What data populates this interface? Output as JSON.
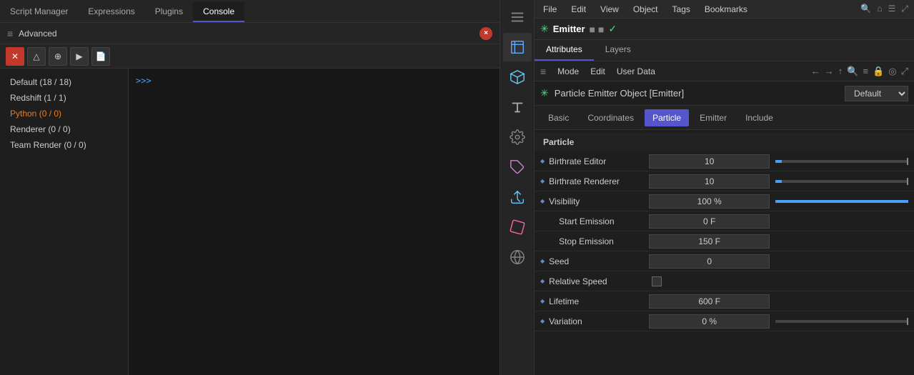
{
  "left_panel": {
    "tabs": [
      {
        "label": "Script Manager",
        "active": false
      },
      {
        "label": "Expressions",
        "active": false
      },
      {
        "label": "Plugins",
        "active": false
      },
      {
        "label": "Console",
        "active": true
      }
    ],
    "header": {
      "title": "Advanced",
      "close_label": "×"
    },
    "toolbar": {
      "buttons": [
        "×",
        "△",
        "⊕",
        "▶",
        "📋"
      ]
    },
    "scripts": [
      {
        "label": "Default (18 / 18)",
        "style": "normal"
      },
      {
        "label": "Redshift (1 / 1)",
        "style": "normal"
      },
      {
        "label": "Python (0 / 0)",
        "style": "python"
      },
      {
        "label": "Renderer (0 / 0)",
        "style": "normal"
      },
      {
        "label": "Team Render (0 / 0)",
        "style": "normal"
      }
    ],
    "console": {
      "prompt": ">>>"
    }
  },
  "right_panel": {
    "top_menu": {
      "items": [
        "File",
        "Edit",
        "View",
        "Object",
        "Tags",
        "Bookmarks"
      ]
    },
    "emitter": {
      "name": "Emitter",
      "status_dots": "■ ■",
      "checkmark": "✓"
    },
    "attr_tabs": [
      {
        "label": "Attributes",
        "active": true
      },
      {
        "label": "Layers",
        "active": false
      }
    ],
    "mode_row": {
      "items": [
        "Mode",
        "Edit",
        "User Data"
      ]
    },
    "object": {
      "title": "Particle Emitter Object [Emitter]",
      "dropdown": "Default"
    },
    "particle_tabs": [
      {
        "label": "Basic",
        "active": false
      },
      {
        "label": "Coordinates",
        "active": false
      },
      {
        "label": "Particle",
        "active": true
      },
      {
        "label": "Emitter",
        "active": false
      },
      {
        "label": "Include",
        "active": false
      }
    ],
    "section": "Particle",
    "properties": [
      {
        "name": "Birthrate Editor",
        "value": "10",
        "has_diamond": true,
        "slider_pct": 5,
        "indent": false
      },
      {
        "name": "Birthrate Renderer",
        "value": "10",
        "has_diamond": true,
        "slider_pct": 5,
        "indent": false
      },
      {
        "name": "Visibility",
        "value": "100 %",
        "has_diamond": true,
        "slider_full": true,
        "indent": false
      },
      {
        "name": "Start Emission",
        "value": "0 F",
        "has_diamond": false,
        "indent": true
      },
      {
        "name": "Stop Emission",
        "value": "150 F",
        "has_diamond": false,
        "indent": true
      },
      {
        "name": "Seed",
        "value": "0",
        "has_diamond": true,
        "indent": false
      },
      {
        "name": "Relative Speed",
        "value": "",
        "has_checkbox": true,
        "has_diamond": true,
        "indent": false
      },
      {
        "name": "Lifetime",
        "value": "600 F",
        "has_diamond": true,
        "indent": false
      },
      {
        "name": "Variation",
        "value": "0 %",
        "has_diamond": true,
        "slider_pct": 0,
        "indent": false
      }
    ]
  }
}
